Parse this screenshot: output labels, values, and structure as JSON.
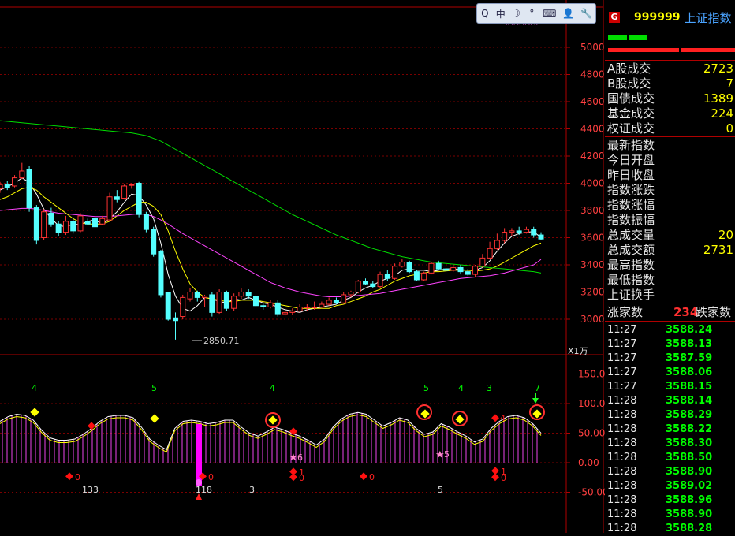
{
  "window": {
    "title_fragment": "上证指数"
  },
  "toolbar": {
    "items": [
      "Q",
      "中",
      "☽",
      "°",
      "⌨",
      "👤",
      "🔧"
    ]
  },
  "main_chart": {
    "y_ticks": [
      "5000",
      "4800",
      "4600",
      "4400",
      "4200",
      "4000",
      "3800",
      "3600",
      "3400",
      "3200",
      "3000"
    ],
    "low_label": "2850.71",
    "unit_label": "X1万"
  },
  "indicator": {
    "y_ticks": [
      "150.00",
      "100.00",
      "50.00",
      "0.00",
      "-50.00"
    ],
    "top_numbers": [
      "4",
      "5",
      "4",
      "5",
      "4",
      "3",
      "7"
    ],
    "bottom_numbers": [
      "133",
      "118",
      "3",
      "5"
    ],
    "marker_labels": [
      "0",
      "0",
      "1",
      "0",
      "0",
      "1",
      "0",
      "6",
      "5",
      "4"
    ]
  },
  "panel": {
    "code": "999999",
    "name": "上证指数",
    "badge": "G",
    "volume_rows": [
      {
        "label": "A股成交",
        "value": "2723"
      },
      {
        "label": "B股成交",
        "value": "7"
      },
      {
        "label": "国债成交",
        "value": "1389"
      },
      {
        "label": "基金成交",
        "value": "224"
      },
      {
        "label": "权证成交",
        "value": "0"
      }
    ],
    "index_rows": [
      {
        "label": "最新指数",
        "value": ""
      },
      {
        "label": "今日开盘",
        "value": ""
      },
      {
        "label": "昨日收盘",
        "value": ""
      },
      {
        "label": "指数涨跌",
        "value": ""
      },
      {
        "label": "指数涨幅",
        "value": ""
      },
      {
        "label": "指数振幅",
        "value": ""
      },
      {
        "label": "总成交量",
        "value": "20"
      },
      {
        "label": "总成交额",
        "value": "2731"
      },
      {
        "label": "最高指数",
        "value": ""
      },
      {
        "label": "最低指数",
        "value": ""
      },
      {
        "label": "上证换手",
        "value": ""
      }
    ],
    "breadth": {
      "up_label": "涨家数",
      "up_value": "234",
      "down_label": "跌家数"
    },
    "ticks": [
      {
        "time": "11:27",
        "price": "3588.24"
      },
      {
        "time": "11:27",
        "price": "3588.13"
      },
      {
        "time": "11:27",
        "price": "3587.59"
      },
      {
        "time": "11:27",
        "price": "3588.06"
      },
      {
        "time": "11:27",
        "price": "3588.15"
      },
      {
        "time": "11:28",
        "price": "3588.14"
      },
      {
        "time": "11:28",
        "price": "3588.29"
      },
      {
        "time": "11:28",
        "price": "3588.22"
      },
      {
        "time": "11:28",
        "price": "3588.30"
      },
      {
        "time": "11:28",
        "price": "3588.50"
      },
      {
        "time": "11:28",
        "price": "3588.90"
      },
      {
        "time": "11:28",
        "price": "3589.02"
      },
      {
        "time": "11:28",
        "price": "3588.96"
      },
      {
        "time": "11:28",
        "price": "3588.90"
      },
      {
        "time": "11:28",
        "price": "3588.28"
      }
    ]
  },
  "chart_data": {
    "type": "candlestick",
    "ylim": [
      2850,
      5100
    ],
    "candles": [
      [
        3960,
        3990,
        3930,
        4010
      ],
      [
        3990,
        3970,
        3950,
        4020
      ],
      [
        3980,
        4040,
        3970,
        4060
      ],
      [
        4040,
        4090,
        4030,
        4150
      ],
      [
        4100,
        3820,
        3790,
        4130
      ],
      [
        3820,
        3580,
        3550,
        3840
      ],
      [
        3600,
        3790,
        3580,
        3810
      ],
      [
        3780,
        3700,
        3680,
        3820
      ],
      [
        3700,
        3640,
        3610,
        3720
      ],
      [
        3640,
        3720,
        3620,
        3760
      ],
      [
        3720,
        3650,
        3630,
        3740
      ],
      [
        3650,
        3760,
        3640,
        3780
      ],
      [
        3720,
        3700,
        3690,
        3740
      ],
      [
        3740,
        3680,
        3660,
        3760
      ],
      [
        3700,
        3740,
        3690,
        3760
      ],
      [
        3730,
        3900,
        3720,
        3930
      ],
      [
        3900,
        3880,
        3860,
        3950
      ],
      [
        3890,
        3980,
        3880,
        3990
      ],
      [
        3990,
        3990,
        3960,
        4000
      ],
      [
        4000,
        3770,
        3750,
        4010
      ],
      [
        3770,
        3660,
        3640,
        3790
      ],
      [
        3660,
        3480,
        3460,
        3680
      ],
      [
        3500,
        3180,
        3160,
        3510
      ],
      [
        3200,
        3000,
        2990,
        3090
      ],
      [
        3010,
        2990,
        2850,
        3050
      ],
      [
        3020,
        3160,
        3000,
        3180
      ],
      [
        3150,
        3200,
        3130,
        3230
      ],
      [
        3200,
        3160,
        3130,
        3210
      ],
      [
        3160,
        3170,
        3090,
        3180
      ],
      [
        3180,
        3050,
        3020,
        3200
      ],
      [
        3050,
        3200,
        3040,
        3220
      ],
      [
        3200,
        3080,
        3060,
        3210
      ],
      [
        3080,
        3170,
        3060,
        3190
      ],
      [
        3170,
        3200,
        3150,
        3230
      ],
      [
        3200,
        3170,
        3150,
        3220
      ],
      [
        3170,
        3100,
        3090,
        3180
      ],
      [
        3100,
        3090,
        3070,
        3120
      ],
      [
        3090,
        3120,
        3080,
        3140
      ],
      [
        3120,
        3040,
        3020,
        3140
      ],
      [
        3040,
        3050,
        3020,
        3080
      ],
      [
        3050,
        3060,
        3030,
        3080
      ],
      [
        3060,
        3090,
        3050,
        3110
      ],
      [
        3090,
        3090,
        3060,
        3110
      ],
      [
        3090,
        3090,
        3070,
        3130
      ],
      [
        3090,
        3110,
        3080,
        3130
      ],
      [
        3110,
        3140,
        3100,
        3160
      ],
      [
        3140,
        3120,
        3110,
        3160
      ],
      [
        3120,
        3180,
        3110,
        3200
      ],
      [
        3180,
        3200,
        3160,
        3210
      ],
      [
        3200,
        3280,
        3190,
        3290
      ],
      [
        3280,
        3260,
        3250,
        3300
      ],
      [
        3260,
        3240,
        3230,
        3280
      ],
      [
        3240,
        3330,
        3230,
        3350
      ],
      [
        3330,
        3300,
        3280,
        3360
      ],
      [
        3300,
        3390,
        3290,
        3410
      ],
      [
        3390,
        3420,
        3380,
        3440
      ],
      [
        3420,
        3350,
        3340,
        3430
      ],
      [
        3350,
        3290,
        3280,
        3360
      ],
      [
        3290,
        3340,
        3280,
        3350
      ],
      [
        3340,
        3410,
        3330,
        3420
      ],
      [
        3410,
        3370,
        3360,
        3430
      ],
      [
        3370,
        3360,
        3340,
        3390
      ],
      [
        3360,
        3380,
        3350,
        3400
      ],
      [
        3380,
        3350,
        3330,
        3400
      ],
      [
        3350,
        3330,
        3320,
        3370
      ],
      [
        3330,
        3390,
        3310,
        3400
      ],
      [
        3390,
        3450,
        3380,
        3480
      ],
      [
        3450,
        3520,
        3440,
        3570
      ],
      [
        3520,
        3580,
        3510,
        3630
      ],
      [
        3580,
        3640,
        3560,
        3670
      ],
      [
        3640,
        3650,
        3610,
        3670
      ],
      [
        3650,
        3640,
        3620,
        3680
      ],
      [
        3640,
        3660,
        3630,
        3680
      ],
      [
        3660,
        3620,
        3600,
        3680
      ],
      [
        3620,
        3590,
        3580,
        3640
      ]
    ],
    "series": [
      {
        "name": "MA5",
        "color": "#ffffff",
        "values": [
          3950,
          3975,
          4000,
          4040,
          4005,
          3920,
          3810,
          3740,
          3690,
          3680,
          3700,
          3695,
          3720,
          3730,
          3700,
          3740,
          3790,
          3860,
          3920,
          3910,
          3840,
          3740,
          3560,
          3330,
          3170,
          3080,
          3060,
          3100,
          3160,
          3150,
          3130,
          3120,
          3150,
          3140,
          3160,
          3140,
          3120,
          3110,
          3090,
          3070,
          3060,
          3050,
          3070,
          3080,
          3090,
          3100,
          3110,
          3140,
          3160,
          3200,
          3230,
          3250,
          3280,
          3300,
          3320,
          3360,
          3370,
          3360,
          3360,
          3350,
          3360,
          3370,
          3370,
          3365,
          3360,
          3360,
          3380,
          3430,
          3500,
          3560,
          3610,
          3630,
          3640,
          3645,
          3600
        ]
      },
      {
        "name": "MA10",
        "color": "#ffff00",
        "values": [
          3880,
          3900,
          3930,
          3960,
          3970,
          3950,
          3900,
          3860,
          3820,
          3780,
          3740,
          3710,
          3700,
          3700,
          3700,
          3720,
          3760,
          3800,
          3830,
          3860,
          3860,
          3830,
          3770,
          3650,
          3500,
          3370,
          3260,
          3200,
          3160,
          3150,
          3140,
          3130,
          3130,
          3140,
          3140,
          3140,
          3130,
          3120,
          3110,
          3100,
          3090,
          3080,
          3080,
          3080,
          3080,
          3080,
          3100,
          3110,
          3130,
          3150,
          3170,
          3200,
          3220,
          3250,
          3280,
          3300,
          3320,
          3330,
          3340,
          3350,
          3350,
          3355,
          3360,
          3360,
          3360,
          3355,
          3360,
          3370,
          3390,
          3420,
          3450,
          3480,
          3510,
          3540,
          3560
        ]
      },
      {
        "name": "MA30",
        "color": "#ff44ff",
        "values": [
          3800,
          3805,
          3810,
          3815,
          3815,
          3810,
          3800,
          3790,
          3780,
          3775,
          3770,
          3765,
          3760,
          3755,
          3755,
          3755,
          3760,
          3765,
          3770,
          3775,
          3770,
          3755,
          3730,
          3700,
          3665,
          3630,
          3600,
          3570,
          3540,
          3510,
          3480,
          3450,
          3420,
          3390,
          3360,
          3330,
          3300,
          3270,
          3250,
          3230,
          3215,
          3200,
          3190,
          3180,
          3170,
          3165,
          3165,
          3165,
          3170,
          3175,
          3180,
          3185,
          3190,
          3200,
          3210,
          3220,
          3230,
          3240,
          3250,
          3260,
          3270,
          3280,
          3290,
          3300,
          3305,
          3310,
          3315,
          3320,
          3330,
          3340,
          3355,
          3370,
          3385,
          3400,
          3440
        ]
      },
      {
        "name": "MA60",
        "color": "#00dd00",
        "values": [
          4460,
          4455,
          4450,
          4445,
          4440,
          4435,
          4430,
          4425,
          4420,
          4415,
          4410,
          4405,
          4400,
          4395,
          4390,
          4385,
          4380,
          4375,
          4370,
          4360,
          4350,
          4330,
          4310,
          4280,
          4250,
          4220,
          4190,
          4160,
          4130,
          4100,
          4070,
          4040,
          4010,
          3980,
          3950,
          3920,
          3890,
          3860,
          3830,
          3800,
          3770,
          3745,
          3720,
          3695,
          3670,
          3645,
          3620,
          3600,
          3580,
          3560,
          3540,
          3520,
          3505,
          3490,
          3475,
          3460,
          3450,
          3440,
          3430,
          3420,
          3415,
          3410,
          3405,
          3400,
          3395,
          3390,
          3385,
          3380,
          3375,
          3370,
          3365,
          3360,
          3355,
          3350,
          3340
        ]
      }
    ]
  }
}
